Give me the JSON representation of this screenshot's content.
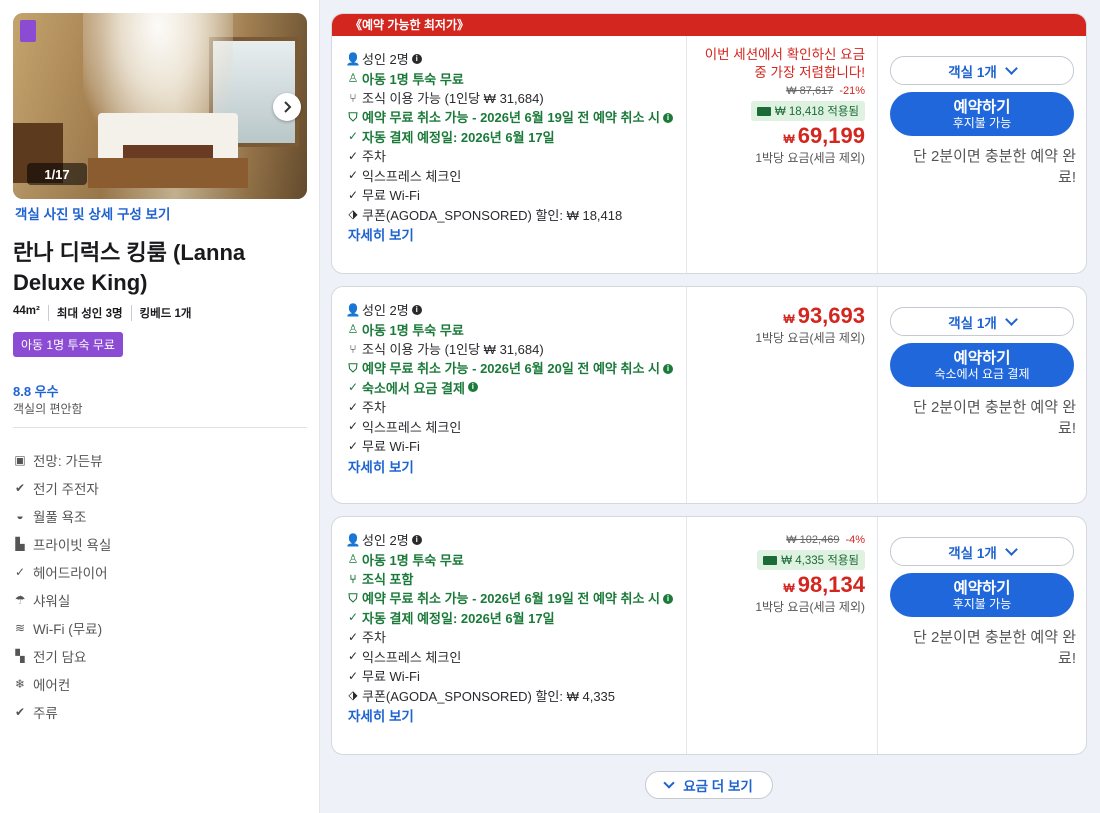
{
  "left": {
    "photo_counter": "1/17",
    "photo_link": "객실 사진 및 상세 구성 보기",
    "room_title": "란나 디럭스 킹룸 (Lanna Deluxe King)",
    "specs": [
      "44m²",
      "최대 성인 3명",
      "킹베드 1개"
    ],
    "kids_badge": "아동 1명 투숙 무료",
    "rating": "8.8 우수",
    "rating_sub": "객실의 편안함",
    "amenities": [
      {
        "icon": "view-icon",
        "label": "전망: 가든뷰"
      },
      {
        "icon": "check-circle-icon",
        "label": "전기 주전자"
      },
      {
        "icon": "bathtub-icon",
        "label": "월풀 욕조"
      },
      {
        "icon": "bathroom-icon",
        "label": "프라이빗 욕실"
      },
      {
        "icon": "check-icon",
        "label": "헤어드라이어"
      },
      {
        "icon": "shower-icon",
        "label": "샤워실"
      },
      {
        "icon": "wifi-icon",
        "label": "Wi-Fi (무료)"
      },
      {
        "icon": "blanket-icon",
        "label": "전기 담요"
      },
      {
        "icon": "snowflake-icon",
        "label": "에어컨"
      },
      {
        "icon": "check-circle-icon",
        "label": "주류"
      }
    ]
  },
  "offers": [
    {
      "banner": "《예약 가능한 최저가》",
      "adults": "성인 2명",
      "kids": "아동 1명 투숙 무료",
      "breakfast": "조식 이용 가능 (1인당 ₩ 31,684)",
      "cancel": "예약 무료 취소 가능 - 2026년 6월 19일 전 예약 취소 시",
      "payment": "자동 결제 예정일: 2026년 6월 17일",
      "parking": "주차",
      "express": "익스프레스 체크인",
      "wifi": "무료 Wi-Fi",
      "coupon": "쿠폰(AGODA_SPONSORED) 할인: ₩ 18,418",
      "details": "자세히 보기",
      "lowest_msg": "이번 세션에서 확인하신 요금 중 가장 저렴합니다!",
      "original_price": "₩ 87,617",
      "discount": "-21%",
      "applied": "₩ 18,418 적용됨",
      "currency": "₩",
      "price": "69,199",
      "per_night": "1박당 요금(세금 제외)",
      "rooms": "객실 1개",
      "book": "예약하기",
      "book_sub": "후지불 가능",
      "quick": "단 2분이면 충분한 예약 완료!"
    },
    {
      "adults": "성인 2명",
      "kids": "아동 1명 투숙 무료",
      "breakfast": "조식 이용 가능 (1인당 ₩ 31,684)",
      "cancel": "예약 무료 취소 가능 - 2026년 6월 20일 전 예약 취소 시",
      "payment": "숙소에서 요금 결제",
      "parking": "주차",
      "express": "익스프레스 체크인",
      "wifi": "무료 Wi-Fi",
      "details": "자세히 보기",
      "currency": "₩",
      "price": "93,693",
      "per_night": "1박당 요금(세금 제외)",
      "rooms": "객실 1개",
      "book": "예약하기",
      "book_sub": "숙소에서 요금 결제",
      "quick": "단 2분이면 충분한 예약 완료!"
    },
    {
      "adults": "성인 2명",
      "kids": "아동 1명 투숙 무료",
      "breakfast": "조식 포함",
      "cancel": "예약 무료 취소 가능 - 2026년 6월 19일 전 예약 취소 시",
      "payment": "자동 결제 예정일: 2026년 6월 17일",
      "parking": "주차",
      "express": "익스프레스 체크인",
      "wifi": "무료 Wi-Fi",
      "coupon": "쿠폰(AGODA_SPONSORED) 할인: ₩ 4,335",
      "details": "자세히 보기",
      "original_price": "₩ 102,469",
      "discount": "-4%",
      "applied": "₩ 4,335 적용됨",
      "currency": "₩",
      "price": "98,134",
      "per_night": "1박당 요금(세금 제외)",
      "rooms": "객실 1개",
      "book": "예약하기",
      "book_sub": "후지불 가능",
      "quick": "단 2분이면 충분한 예약 완료!"
    }
  ],
  "more_rates": "요금 더 보기",
  "colors": {
    "accent": "#2067db",
    "price": "#d3261f",
    "green": "#1b7a3a",
    "purple": "#8b4bd2"
  }
}
